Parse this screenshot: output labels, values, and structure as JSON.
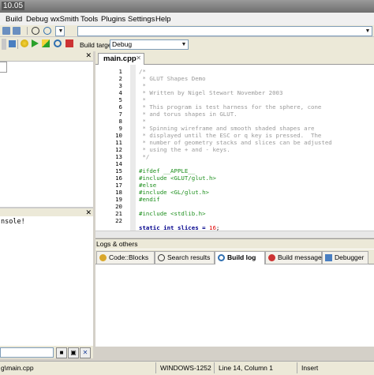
{
  "window": {
    "title": "10.05"
  },
  "menu": [
    "Build",
    "Debug",
    "wxSmith",
    "Tools",
    "Plugins",
    "Settings",
    "Help"
  ],
  "toolbar": {
    "build_target_label": "Build target:",
    "build_target_value": "Debug"
  },
  "left_bottom": {
    "text": "nsole!"
  },
  "editor": {
    "tab": "main.cpp",
    "line_numbers": [
      "1",
      "2",
      "3",
      "4",
      "5",
      "6",
      "7",
      "8",
      "9",
      "10",
      "11",
      "12",
      "13",
      "14",
      "15",
      "16",
      "17",
      "18",
      "19",
      "20",
      "21",
      "22"
    ],
    "lines": [
      "/*",
      " * GLUT Shapes Demo",
      " *",
      " * Written by Nigel Stewart November 2003",
      " *",
      " * This program is test harness for the sphere, cone",
      " * and torus shapes in GLUT.",
      " *",
      " * Spinning wireframe and smooth shaded shapes are",
      " * displayed until the ESC or q key is pressed.  The",
      " * number of geometry stacks and slices can be adjusted",
      " * using the + and - keys.",
      " */",
      "",
      "#ifdef __APPLE__",
      "#include <GLUT/glut.h>",
      "#else",
      "#include <GL/glut.h>",
      "#endif",
      "",
      "#include <stdlib.h>",
      "",
      "static int slices = 16;"
    ]
  },
  "logs": {
    "header": "Logs & others",
    "tabs": [
      "Code::Blocks",
      "Search results",
      "Build log",
      "Build messages",
      "Debugger"
    ],
    "active_tab": "Build log"
  },
  "status": {
    "file": "g\\main.cpp",
    "encoding": "WINDOWS-1252",
    "position": "Line 14, Column 1",
    "mode": "Insert"
  },
  "colors": {
    "comment": "#9a9a9a",
    "preproc": "#1d8f1d",
    "keyword": "#00008b",
    "number": "#e00000"
  }
}
